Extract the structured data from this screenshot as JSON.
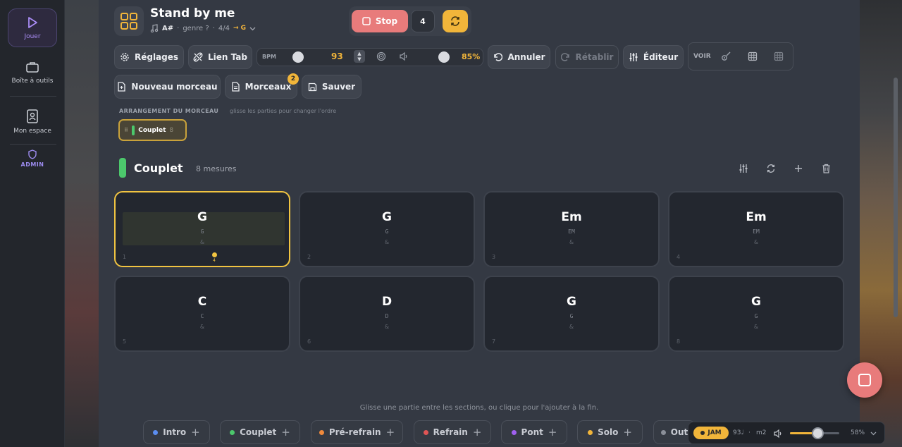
{
  "sidebar": {
    "items": [
      {
        "label": "Jouer",
        "icon": "play-icon"
      },
      {
        "label": "Boîte à outils",
        "icon": "toolbox-icon"
      },
      {
        "label": "Mon espace",
        "icon": "contact-book-icon"
      },
      {
        "label": "ADMIN",
        "icon": "shield-icon"
      }
    ]
  },
  "header": {
    "title": "Stand by me",
    "key": "A#",
    "genre": "genre ?",
    "time_signature": "4/4",
    "capo": "→ G"
  },
  "transport": {
    "stop_label": "Stop",
    "count": "4"
  },
  "toolbar": {
    "settings_label": "Réglages",
    "tab_link_label": "Lien Tab",
    "bpm_label": "BPM",
    "bpm_value": "93",
    "volume_value": "85%",
    "undo_label": "Annuler",
    "redo_label": "Rétablir",
    "editor_label": "Éditeur",
    "view_label": "VOIR",
    "new_song_label": "Nouveau morceau",
    "songs_label": "Morceaux",
    "songs_badge": "2",
    "save_label": "Sauver"
  },
  "arrangement": {
    "title": "ARRANGEMENT DU MORCEAU",
    "hint": "glisse les parties pour changer l'ordre",
    "chip_label": "Couplet",
    "chip_count": "8"
  },
  "section": {
    "name": "Couplet",
    "measures": "8 mesures",
    "color": "#4cc86c"
  },
  "measures": [
    {
      "chord": "G",
      "sub": "G",
      "beat": "&",
      "num": "1",
      "active": true,
      "playhead": "4"
    },
    {
      "chord": "G",
      "sub": "G",
      "beat": "&",
      "num": "2"
    },
    {
      "chord": "Em",
      "sub": "EM",
      "beat": "&",
      "num": "3"
    },
    {
      "chord": "Em",
      "sub": "EM",
      "beat": "&",
      "num": "4"
    },
    {
      "chord": "C",
      "sub": "C",
      "beat": "&",
      "num": "5"
    },
    {
      "chord": "D",
      "sub": "D",
      "beat": "&",
      "num": "6"
    },
    {
      "chord": "G",
      "sub": "G",
      "beat": "&",
      "num": "7"
    },
    {
      "chord": "G",
      "sub": "G",
      "beat": "&",
      "num": "8"
    }
  ],
  "footer": {
    "hint": "Glisse une partie entre les sections, ou clique pour l'ajouter à la fin.",
    "parts": [
      {
        "label": "Intro",
        "color": "#5b8def"
      },
      {
        "label": "Couplet",
        "color": "#4cc86c"
      },
      {
        "label": "Pré-refrain",
        "color": "#f08a3c"
      },
      {
        "label": "Refrain",
        "color": "#e05555"
      },
      {
        "label": "Pont",
        "color": "#a060f0"
      },
      {
        "label": "Solo",
        "color": "#f1b53a"
      },
      {
        "label": "Out",
        "color": "#8a8f98"
      }
    ]
  },
  "jam": {
    "label": "JAM",
    "tempo": "93♩",
    "sep": "·",
    "measure": "m2",
    "volume": "58%",
    "volume_fraction": 0.58
  }
}
